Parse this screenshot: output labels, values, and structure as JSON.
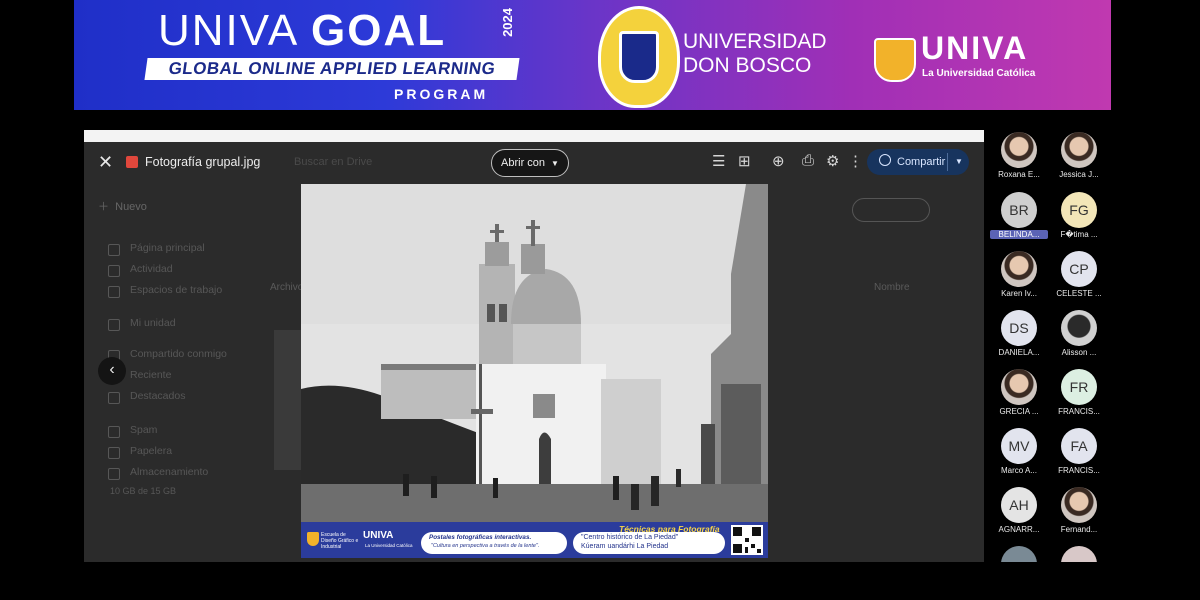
{
  "banner": {
    "univa_light": "UNIVA ",
    "goal_bold": "GOAL",
    "year": "2024",
    "subtitle": "GLOBAL ONLINE APPLIED LEARNING",
    "program": "PROGRAM",
    "udb_line1": "UNIVERSIDAD",
    "udb_line2": "DON BOSCO",
    "univa_name": "UNIVA",
    "univa_sub": "La Universidad Católica",
    "colors": {
      "start": "#1f2fc8",
      "end": "#c039b0"
    }
  },
  "viewer": {
    "file_name": "Fotografía grupal.jpg",
    "search_placeholder": "Buscar en Drive",
    "open_with": "Abrir con",
    "share": "Compartir",
    "share_color": "#17345e",
    "tools": [
      "add-to-folder-icon",
      "add-comment-icon",
      "print-icon",
      "settings-icon",
      "more-icon"
    ]
  },
  "drive_bg": {
    "new_label": "Nuevo",
    "nav": [
      "Página principal",
      "Actividad",
      "Espacios de trabajo",
      "Mi unidad",
      "Compartido conmigo",
      "Reciente",
      "Destacados",
      "Spam",
      "Papelera",
      "Almacenamiento"
    ],
    "storage_note": "10 GB de 15 GB",
    "archivo": "Archivo",
    "sort_label": "Nombre"
  },
  "photo": {
    "footer_title": "Técnicas para Fotografía",
    "school": "Escuela de Diseño Gráfico e Industrial",
    "logo": "UNIVA",
    "logo_sub": "La Universidad Católica",
    "pill1_title": "Postales fotográficas interactivas.",
    "pill1_sub": "\"Cultura en perspectiva a través de la lente\".",
    "pill2_line1": "\"Centro histórico de La Piedad\"",
    "pill2_line2": "Kúeram uandárhi La Piedad"
  },
  "participants": [
    {
      "initials": "",
      "name": "Roxana E...",
      "photo": true
    },
    {
      "initials": "",
      "name": "Jessica J...",
      "photo": true
    },
    {
      "initials": "BR",
      "name": "BELINDA...",
      "photo": false,
      "highlight": true
    },
    {
      "initials": "FG",
      "name": "F�tima ...",
      "photo": false
    },
    {
      "initials": "",
      "name": "Karen Iv...",
      "photo": true
    },
    {
      "initials": "CP",
      "name": "CELESTE ...",
      "photo": false
    },
    {
      "initials": "DS",
      "name": "DANIELA...",
      "photo": false
    },
    {
      "initials": "",
      "name": "Alisson ...",
      "photo": true
    },
    {
      "initials": "",
      "name": "GRECIA ...",
      "photo": true
    },
    {
      "initials": "FR",
      "name": "FRANCIS...",
      "photo": false
    },
    {
      "initials": "MV",
      "name": "Marco A...",
      "photo": false
    },
    {
      "initials": "FA",
      "name": "FRANCIS...",
      "photo": false
    },
    {
      "initials": "AH",
      "name": "AGNARR...",
      "photo": false
    },
    {
      "initials": "",
      "name": "Fernand...",
      "photo": true
    }
  ]
}
